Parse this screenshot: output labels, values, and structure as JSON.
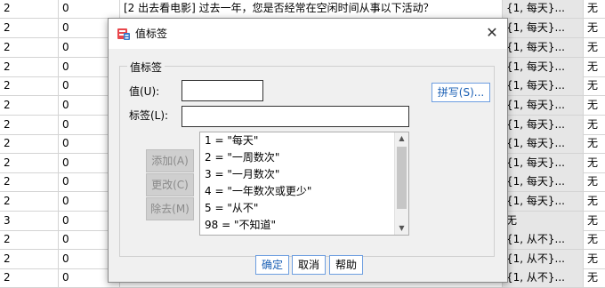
{
  "grid": {
    "rows": [
      {
        "c0": "2",
        "c1": "0",
        "c2": "[2  出去看电影]  过去一年，您是否经常在空闲时间从事以下活动？",
        "c3": "{1, 每天}...",
        "c4": "无"
      },
      {
        "c0": "2",
        "c1": "0",
        "c2": "",
        "c3": "{1, 每天}...",
        "c4": "无"
      },
      {
        "c0": "2",
        "c1": "0",
        "c2": "",
        "c3": "{1, 每天}...",
        "c4": "无"
      },
      {
        "c0": "2",
        "c1": "0",
        "c2": "",
        "c3": "{1, 每天}...",
        "c4": "无"
      },
      {
        "c0": "2",
        "c1": "0",
        "c2": "",
        "c3": "{1, 每天}...",
        "c4": "无"
      },
      {
        "c0": "2",
        "c1": "0",
        "c2": "",
        "c3": "{1, 每天}...",
        "c4": "无"
      },
      {
        "c0": "2",
        "c1": "0",
        "c2": "",
        "c3": "{1, 每天}...",
        "c4": "无"
      },
      {
        "c0": "2",
        "c1": "0",
        "c2": "",
        "c3": "{1, 每天}...",
        "c4": "无"
      },
      {
        "c0": "2",
        "c1": "0",
        "c2": "",
        "c3": "{1, 每天}...",
        "c4": "无"
      },
      {
        "c0": "2",
        "c1": "0",
        "c2": "",
        "c3": "{1, 每天}...",
        "c4": "无"
      },
      {
        "c0": "2",
        "c1": "0",
        "c2": "",
        "c3": "{1, 每天}...",
        "c4": "无"
      },
      {
        "c0": "3",
        "c1": "0",
        "c2": "",
        "c3": "无",
        "c4": "无"
      },
      {
        "c0": "2",
        "c1": "0",
        "c2": "",
        "c3": "{1, 从不}...",
        "c4": "无"
      },
      {
        "c0": "2",
        "c1": "0",
        "c2": "",
        "c3": "{1, 从不}...",
        "c4": "无"
      },
      {
        "c0": "2",
        "c1": "0",
        "c2": "",
        "c3": "{1, 从不}...",
        "c4": "无"
      }
    ]
  },
  "dialog": {
    "title": "值标签",
    "close_glyph": "✕",
    "group_legend": "值标签",
    "value_label": "值(U):",
    "label_label": "标签(L):",
    "value_input": "",
    "label_input": "",
    "spelling_button": "拼写(S)...",
    "add_button": "添加(A)",
    "change_button": "更改(C)",
    "remove_button": "除去(M)",
    "list_items": [
      "1 = \"每天\"",
      "2 = \"一周数次\"",
      "3 = \"一月数次\"",
      "4 = \"一年数次或更少\"",
      "5 = \"从不\"",
      "98 = \"不知道\""
    ],
    "ok_button": "确定",
    "cancel_button": "取消",
    "help_button": "帮助"
  }
}
